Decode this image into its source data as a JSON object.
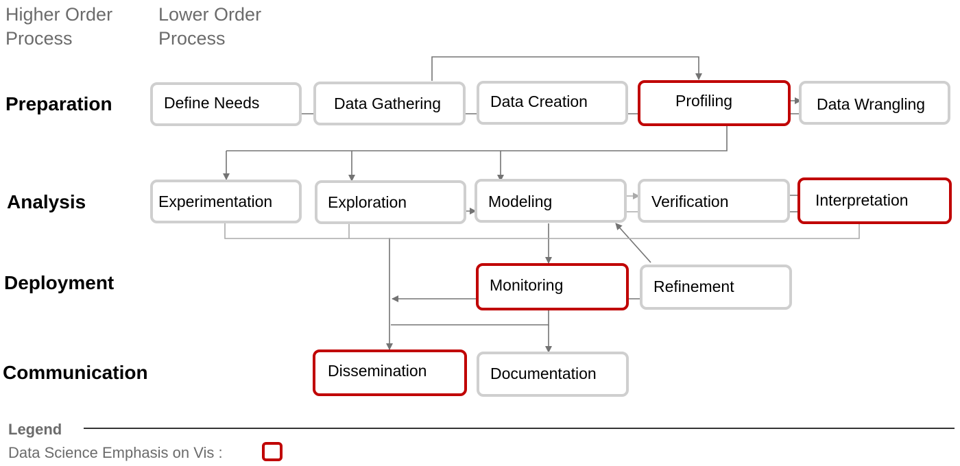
{
  "headers": {
    "higher": [
      "Higher Order",
      "Process"
    ],
    "lower": [
      "Lower Order",
      "Process"
    ]
  },
  "stages": {
    "preparation": "Preparation",
    "analysis": "Analysis",
    "deployment": "Deployment",
    "communication": "Communication"
  },
  "nodes": {
    "define_needs": {
      "label": "Define Needs",
      "emphasis": false
    },
    "data_gathering": {
      "label": "Data Gathering",
      "emphasis": false
    },
    "data_creation": {
      "label": "Data Creation",
      "emphasis": false
    },
    "profiling": {
      "label": "Profiling",
      "emphasis": true
    },
    "data_wrangling": {
      "label": "Data Wrangling",
      "emphasis": false
    },
    "experimentation": {
      "label": "Experimentation",
      "emphasis": false
    },
    "exploration": {
      "label": "Exploration",
      "emphasis": false
    },
    "modeling": {
      "label": "Modeling",
      "emphasis": false
    },
    "verification": {
      "label": "Verification",
      "emphasis": false
    },
    "interpretation": {
      "label": "Interpretation",
      "emphasis": true
    },
    "monitoring": {
      "label": "Monitoring",
      "emphasis": true
    },
    "refinement": {
      "label": "Refinement",
      "emphasis": false
    },
    "dissemination": {
      "label": "Dissemination",
      "emphasis": true
    },
    "documentation": {
      "label": "Documentation",
      "emphasis": false
    }
  },
  "edges": [
    {
      "from": "define_needs",
      "to": "data_gathering"
    },
    {
      "from": "data_gathering",
      "to": "data_creation"
    },
    {
      "from": "data_creation",
      "to": "profiling"
    },
    {
      "from": "data_gathering",
      "to": "profiling"
    },
    {
      "from": "profiling",
      "to": "data_wrangling"
    },
    {
      "from": "data_wrangling",
      "to": "profiling"
    },
    {
      "from": "profiling",
      "to": "experimentation"
    },
    {
      "from": "profiling",
      "to": "exploration"
    },
    {
      "from": "profiling",
      "to": "modeling"
    },
    {
      "from": "exploration",
      "to": "modeling"
    },
    {
      "from": "modeling",
      "to": "verification"
    },
    {
      "from": "verification",
      "to": "modeling"
    },
    {
      "from": "verification",
      "to": "interpretation"
    },
    {
      "from": "interpretation",
      "to": "verification"
    },
    {
      "from": "modeling",
      "to": "monitoring"
    },
    {
      "from": "refinement",
      "to": "modeling"
    },
    {
      "from": "monitoring",
      "to": "refinement"
    },
    {
      "from": "monitoring",
      "to": "dissemination"
    },
    {
      "from": "monitoring",
      "to": "documentation"
    },
    {
      "from": "analysis",
      "to": "dissemination"
    }
  ],
  "legend": {
    "title": "Legend",
    "item": "Data Science Emphasis on Vis :",
    "emphasis_color": "#c00000"
  },
  "colors": {
    "emphasis": "#c00000",
    "normal_border": "#cfcfcf",
    "arrow": "#737373"
  }
}
